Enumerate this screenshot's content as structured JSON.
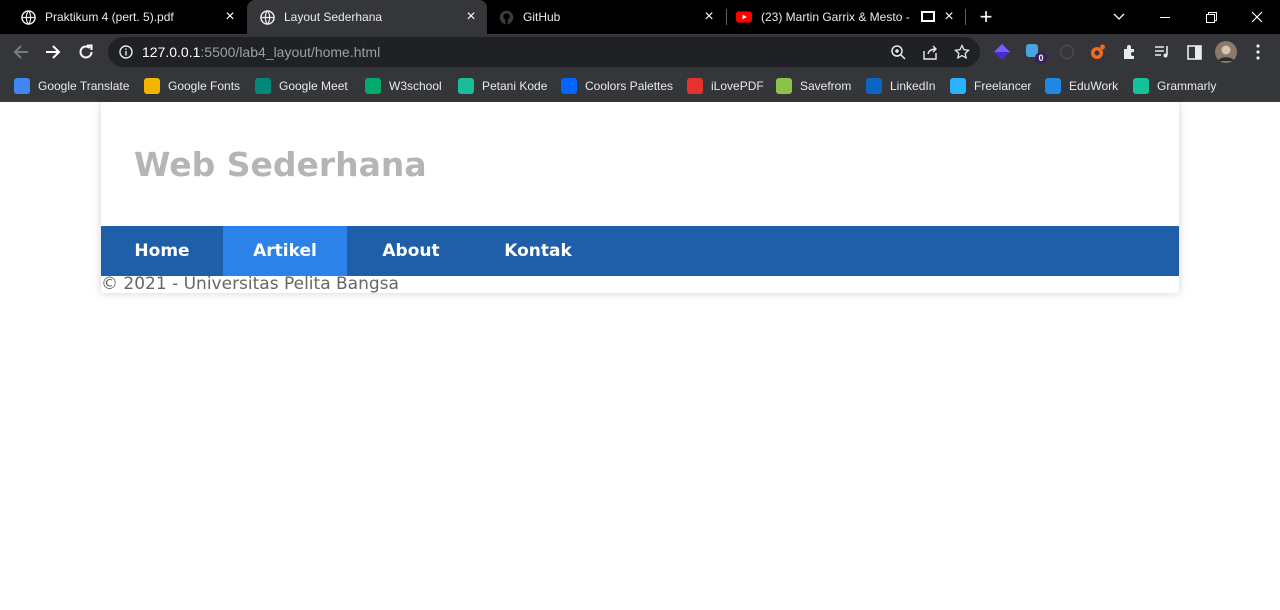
{
  "browser": {
    "tabs": [
      {
        "title": "Praktikum 4 (pert. 5).pdf",
        "icon": "globe-icon"
      },
      {
        "title": "Layout Sederhana",
        "icon": "globe-icon",
        "active": true
      },
      {
        "title": "GitHub",
        "icon": "github-icon"
      },
      {
        "title": "(23) Martin Garrix & Mesto -",
        "icon": "youtube-icon"
      }
    ],
    "url": {
      "host": "127.0.0.1",
      "path": ":5500/lab4_layout/home.html"
    },
    "extension_badge": "0",
    "bookmarks": [
      {
        "label": "Google Translate",
        "icon": "google-translate-icon",
        "color": "#4285f4"
      },
      {
        "label": "Google Fonts",
        "icon": "google-fonts-icon",
        "color": "#f4b400"
      },
      {
        "label": "Google Meet",
        "icon": "google-meet-icon",
        "color": "#00897b"
      },
      {
        "label": "W3school",
        "icon": "w3school-icon",
        "color": "#04aa6d"
      },
      {
        "label": "Petani Kode",
        "icon": "petani-kode-icon",
        "color": "#1abc9c"
      },
      {
        "label": "Coolors Palettes",
        "icon": "coolors-icon",
        "color": "#0066ff"
      },
      {
        "label": "iLovePDF",
        "icon": "ilovepdf-icon",
        "color": "#e5322d"
      },
      {
        "label": "Savefrom",
        "icon": "savefrom-icon",
        "color": "#8bc34a"
      },
      {
        "label": "LinkedIn",
        "icon": "linkedin-icon",
        "color": "#0a66c2"
      },
      {
        "label": "Freelancer",
        "icon": "freelancer-icon",
        "color": "#29b2fe"
      },
      {
        "label": "EduWork",
        "icon": "eduwork-icon",
        "color": "#1e88e5"
      },
      {
        "label": "Grammarly",
        "icon": "grammarly-icon",
        "color": "#15c39a"
      }
    ]
  },
  "page": {
    "title": "Web Sederhana",
    "nav": [
      {
        "label": "Home"
      },
      {
        "label": "Artikel",
        "active": true
      },
      {
        "label": "About"
      },
      {
        "label": "Kontak"
      }
    ],
    "footer": "© 2021 - Universitas Pelita Bangsa"
  },
  "colors": {
    "nav_bg": "#1f5faa",
    "nav_active": "#2b83ea",
    "title_color": "#b5b5b5"
  }
}
